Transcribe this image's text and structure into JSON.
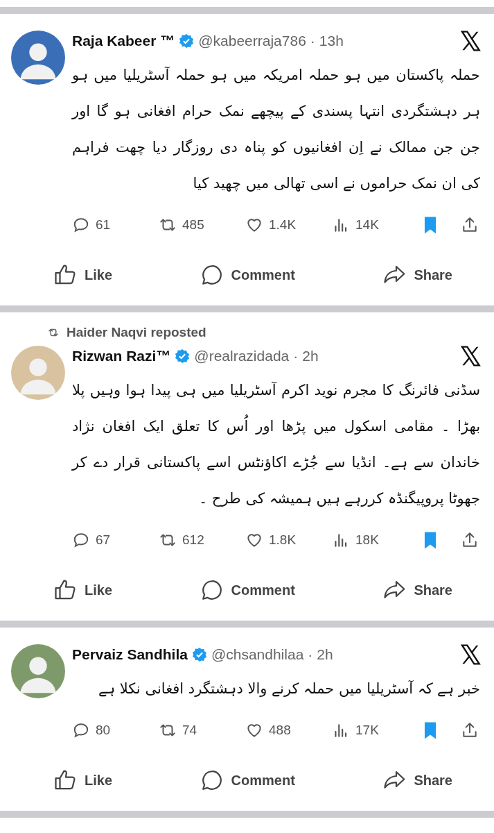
{
  "posts": [
    {
      "name": "Raja Kabeer ™",
      "verified": true,
      "handle": "@kabeerraja786",
      "separator": "·",
      "time": "13h",
      "text": "حملہ پاکستان میں ہو حملہ امریکہ میں ہو حملہ آسٹریلیا میں ہو ہر دہشتگردی انتہا پسندی کے پیچھے نمک حرام افغانی ہو گا اور جن جن ممالک نے اِن افغانیوں کو پناہ دی روزگار دیا چھت فراہم کی ان نمک حراموں نے اسی تھالی میں چھید کیا",
      "replies": "61",
      "reposts": "485",
      "likes": "1.4K",
      "views": "14K",
      "bookmarked": true,
      "actions": [
        "Like",
        "Comment",
        "Share"
      ]
    },
    {
      "reposted_by": "Haider Naqvi reposted",
      "name": "Rizwan Razi™",
      "verified": true,
      "handle": "@realrazidada",
      "separator": "·",
      "time": "2h",
      "text": "سڈنی فائرنگ کا مجرم نوید اکرم آسٹریلیا میں ہی پیدا ہوا وہیں پلا بھڑا ۔ مقامی اسکول میں پڑھا اور اُس کا تعلق ایک افغان نژاد خاندان سے ہے۔ انڈیا سے جُڑے اکاؤنٹس اسے پاکستانی قرار دے کر جھوٹا پروپیگنڈہ کررہے ہیں ہمیشہ کی طرح ۔",
      "replies": "67",
      "reposts": "612",
      "likes": "1.8K",
      "views": "18K",
      "bookmarked": true,
      "actions": [
        "Like",
        "Comment",
        "Share"
      ]
    },
    {
      "name": "Pervaiz Sandhila",
      "verified": true,
      "handle": "@chsandhilaa",
      "separator": "·",
      "time": "2h",
      "text": "خبر ہے کہ آسٹریلیا میں حملہ کرنے والا دہشتگرد افغانی نکلا ہے",
      "replies": "80",
      "reposts": "74",
      "likes": "488",
      "views": "17K",
      "bookmarked": true,
      "actions": [
        "Like",
        "Comment",
        "Share"
      ]
    }
  ]
}
